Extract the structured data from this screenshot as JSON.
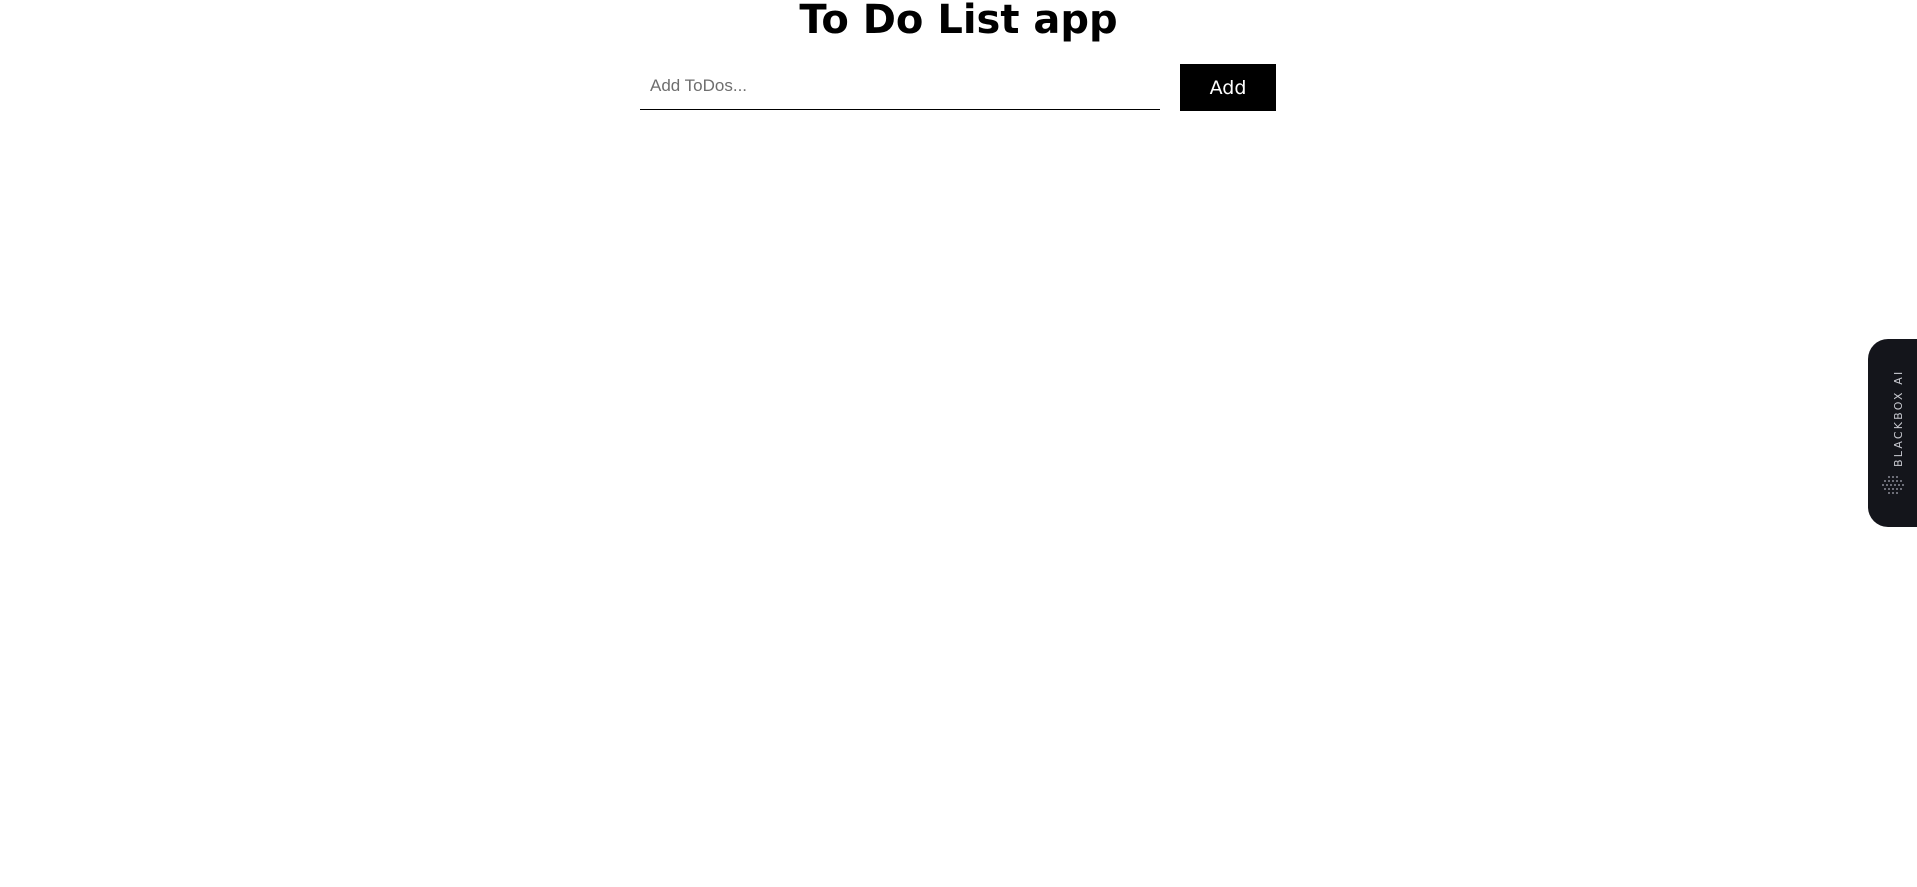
{
  "header": {
    "title": "To Do List app"
  },
  "todo_form": {
    "input_placeholder": "Add ToDos...",
    "input_value": "",
    "add_button_label": "Add"
  },
  "todos": [],
  "extension_tab": {
    "label": "BLACKBOX AI",
    "icon": "blackbox-dots-icon",
    "background_color": "#14151b"
  },
  "colors": {
    "page_background": "#ffffff",
    "button_background": "#000000",
    "button_text": "#ffffff"
  }
}
